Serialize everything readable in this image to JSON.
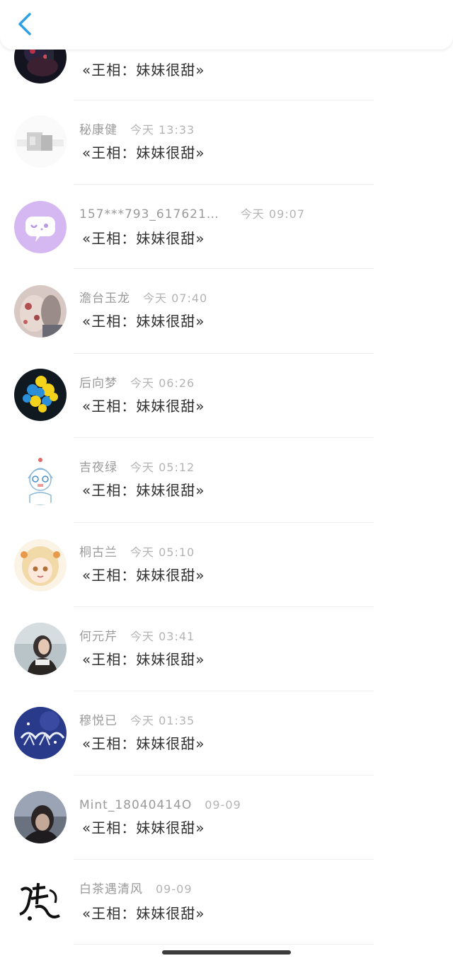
{
  "header": {
    "back_icon": "chevron-left-icon",
    "accent_color": "#2c9fe6"
  },
  "list": {
    "items": [
      {
        "name": "",
        "time": "",
        "message": "«王相：妹妹很甜»",
        "avatar": "dark-figure-avatar"
      },
      {
        "name": "秘康健",
        "time": "今天 13:33",
        "message": "«王相：妹妹很甜»",
        "avatar": "pale-sketch-avatar"
      },
      {
        "name": "157***793_617621…",
        "time": "今天 09:07",
        "message": "«王相：妹妹很甜»",
        "avatar": "chat-bubble-avatar"
      },
      {
        "name": "澹台玉龙",
        "time": "今天 07:40",
        "message": "«王相：妹妹很甜»",
        "avatar": "floral-photo-avatar"
      },
      {
        "name": "后向梦",
        "time": "今天 06:26",
        "message": "«王相：妹妹很甜»",
        "avatar": "balloons-avatar"
      },
      {
        "name": "吉夜绿",
        "time": "今天 05:12",
        "message": "«王相：妹妹很甜»",
        "avatar": "cartoon-girl-avatar"
      },
      {
        "name": "桐古兰",
        "time": "今天 05:10",
        "message": "«王相：妹妹很甜»",
        "avatar": "anime-girl-avatar"
      },
      {
        "name": "何元芹",
        "time": "今天 03:41",
        "message": "«王相：妹妹很甜»",
        "avatar": "portrait-photo-avatar"
      },
      {
        "name": "穆悦已",
        "time": "今天 01:35",
        "message": "«王相：妹妹很甜»",
        "avatar": "blue-art-avatar"
      },
      {
        "name": "Mint_18040414O",
        "time": "09-09",
        "message": "«王相：妹妹很甜»",
        "avatar": "dark-portrait-avatar"
      },
      {
        "name": "白茶遇清风",
        "time": "09-09",
        "message": "«王相：妹妹很甜»",
        "avatar": "calligraphy-avatar"
      }
    ]
  }
}
